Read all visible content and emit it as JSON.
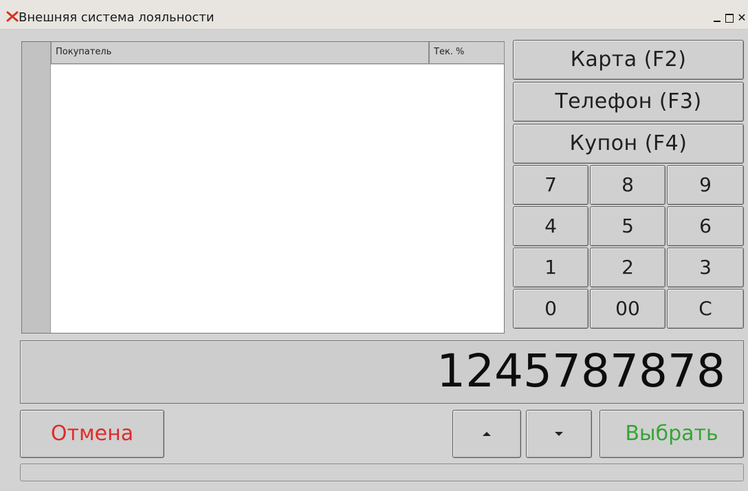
{
  "window": {
    "title": "Внешняя система лояльности",
    "close_glyph": "✕"
  },
  "grid": {
    "columns": [
      "Покупатель",
      "Тек. %"
    ],
    "rows": []
  },
  "buttons": {
    "card": "Карта (F2)",
    "phone": "Телефон (F3)",
    "coupon": "Купон (F4)",
    "cancel": "Отмена",
    "select": "Выбрать"
  },
  "keypad": [
    "7",
    "8",
    "9",
    "4",
    "5",
    "6",
    "1",
    "2",
    "3",
    "0",
    "00",
    "C"
  ],
  "display": {
    "value": "1245787878"
  },
  "colors": {
    "cancel_text": "#e12a2a",
    "select_text": "#35a435",
    "title_x": "#d8311f"
  },
  "icons": {
    "up": "triangle-up-icon",
    "down": "triangle-down-icon",
    "app": "close-x-icon"
  }
}
